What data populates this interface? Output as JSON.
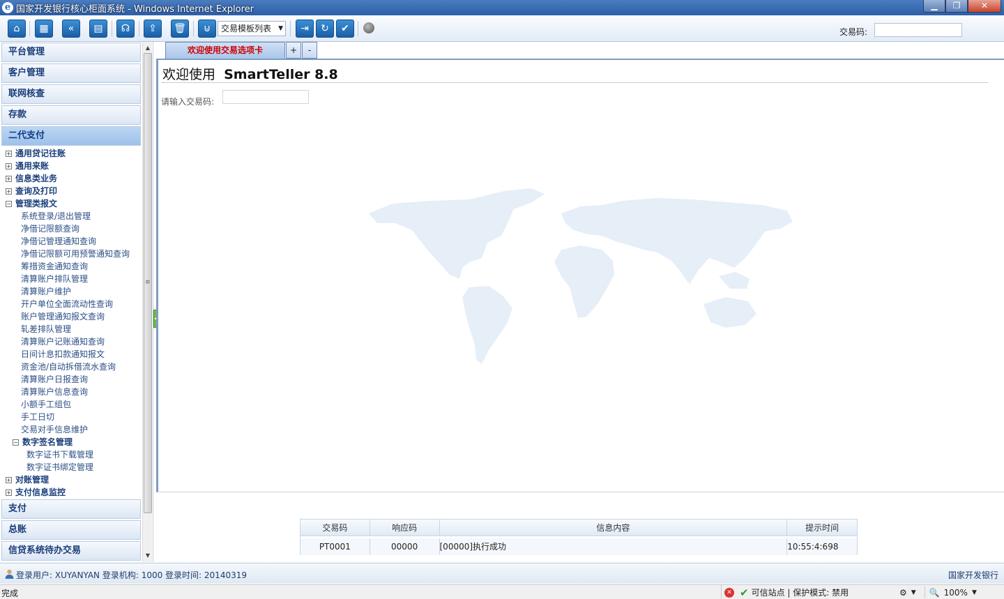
{
  "window": {
    "title": "国家开发银行核心柜面系统 - Windows Internet Explorer"
  },
  "toolbar": {
    "template_select": "交易模板列表",
    "tx_code_label": "交易码:"
  },
  "sidebar": {
    "panels_top": [
      "平台管理",
      "客户管理",
      "联网核查",
      "存款",
      "二代支付"
    ],
    "active_panel": "二代支付",
    "tree": {
      "g1": "通用贷记往账",
      "g2": "通用来账",
      "g3": "信息类业务",
      "g4": "查询及打印",
      "g5": "管理类报文",
      "leaves": [
        "系统登录/退出管理",
        "净借记限额查询",
        "净借记管理通知查询",
        "净借记限额可用预警通知查询",
        "筹措资金通知查询",
        "清算账户排队管理",
        "清算账户维护",
        "开户单位全面流动性查询",
        "账户管理通知报文查询",
        "轧差排队管理",
        "清算账户记账通知查询",
        "日间计息扣款通知报文",
        "资金池/自动拆借流水查询",
        "清算账户日报查询",
        "清算账户信息查询",
        "小额手工组包",
        "手工日切",
        "交易对手信息维护"
      ],
      "sub_group": "数字签名管理",
      "sub_leaves": [
        "数字证书下载管理",
        "数字证书绑定管理"
      ],
      "g6": "对账管理",
      "g7": "支付信息监控"
    },
    "panels_bottom": [
      "支付",
      "总账",
      "信贷系统待办交易"
    ]
  },
  "main": {
    "tab_label": "欢迎使用交易选项卡",
    "tab_add": "+",
    "tab_remove": "-",
    "welcome_prefix": "欢迎使用",
    "welcome_product": "SmartTeller 8.8",
    "prompt_label": "请输入交易码:"
  },
  "messages": {
    "headers": [
      "交易码",
      "响应码",
      "信息内容",
      "提示时间"
    ],
    "row": [
      "PT0001",
      "00000",
      "[00000]执行成功",
      "10:55:4:698"
    ]
  },
  "loginbar": {
    "text": "登录用户: XUYANYAN 登录机构: 1000 登录时间: 20140319",
    "bank": "国家开发银行"
  },
  "ie_status": {
    "done": "完成",
    "zone": "可信站点 | 保护模式: 禁用",
    "zoom": "100%"
  }
}
